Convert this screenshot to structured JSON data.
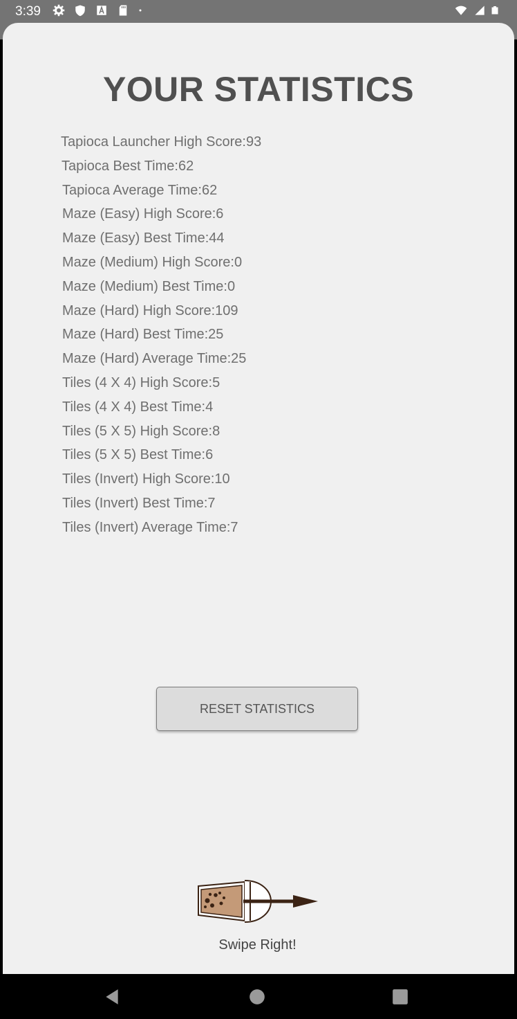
{
  "status_bar": {
    "time": "3:39",
    "left_icons": [
      "gear-icon",
      "shield-icon",
      "a-box-icon",
      "sd-card-icon",
      "dot-icon"
    ],
    "right_icons": [
      "wifi-icon",
      "signal-icon",
      "battery-icon"
    ]
  },
  "title": "YOUR STATISTICS",
  "stats": [
    "Tapioca Launcher High Score:93",
    "Tapioca Best Time:62",
    "Tapioca Average Time:62",
    "Maze (Easy) High Score:6",
    "Maze (Easy) Best Time:44",
    "Maze (Medium) High Score:0",
    "Maze (Medium) Best Time:0",
    "Maze (Hard) High Score:109",
    "Maze (Hard) Best Time:25",
    "Maze (Hard) Average Time:25",
    "Tiles (4 X 4) High Score:5",
    "Tiles (4 X 4) Best Time:4",
    "Tiles (5 X 5) High Score:8",
    "Tiles (5 X 5) Best Time:6",
    "Tiles (Invert) High Score:10",
    "Tiles (Invert) Best Time:7",
    "Tiles (Invert) Average Time:7"
  ],
  "reset_button": "RESET STATISTICS",
  "swipe_label": "Swipe Right!",
  "colors": {
    "status_bar": "#747474",
    "background": "#f0f0f0",
    "title": "#505050",
    "stat_text": "#6f6f6f",
    "button_bg": "#dcdcdc",
    "tea": "#c49a78",
    "arrow": "#3b2314"
  }
}
